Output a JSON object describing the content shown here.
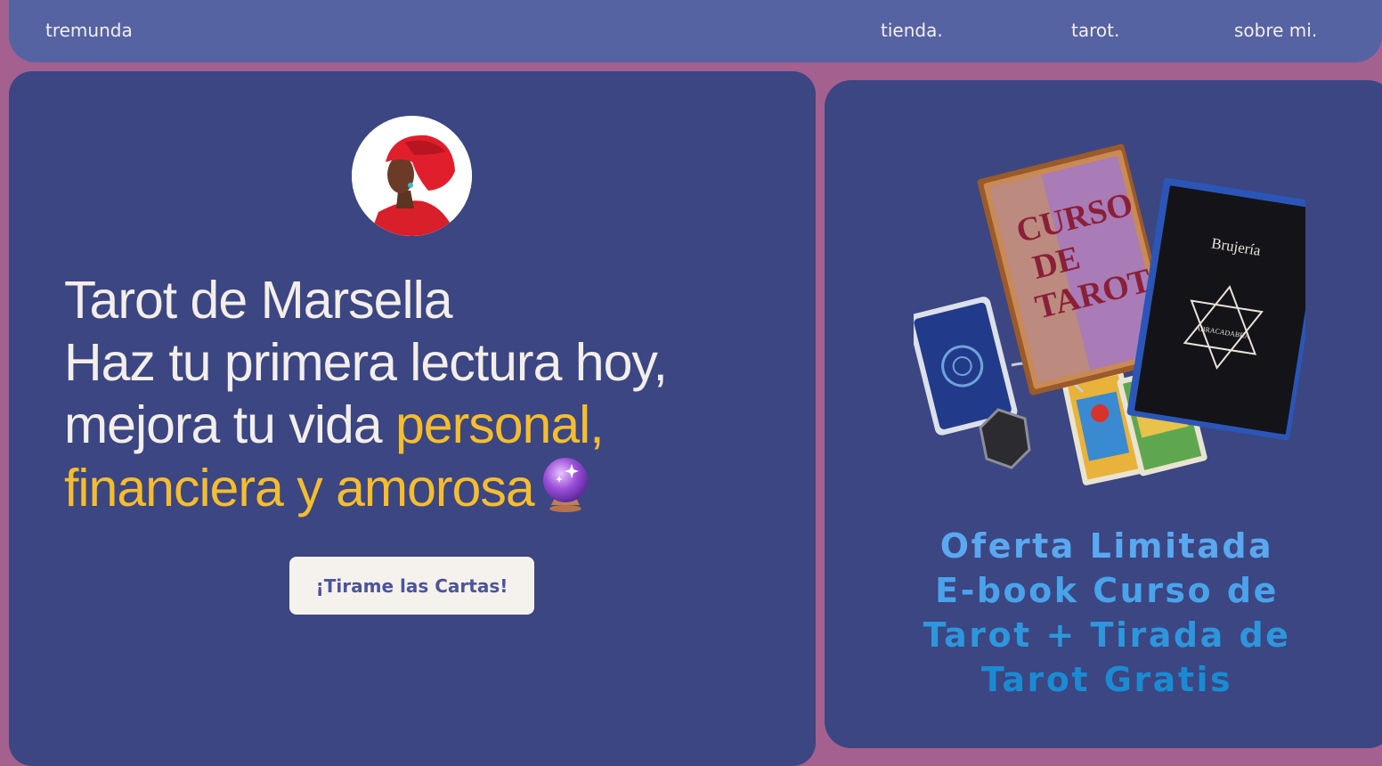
{
  "nav": {
    "brand": "tremunda",
    "links": [
      "tienda.",
      "tarot.",
      "sobre mi."
    ]
  },
  "hero": {
    "avatar": "tarot-reader-avatar",
    "title": "Tarot de Marsella",
    "line2": "Haz tu primera lectura hoy,",
    "line3_plain": "mejora tu vida ",
    "line3_accent": "personal,",
    "line4_accent": "financiera y amorosa",
    "cta_label": "¡Tirame las Cartas!"
  },
  "promo": {
    "image": "tarot-ebook-bundle",
    "book1_title_a": "CURSO",
    "book1_title_b": "DE",
    "book1_title_c": "TAROT",
    "book2_title": "Brujería",
    "offer_line1": "Oferta Limitada",
    "offer_line2": " E-book Curso de",
    "offer_line3": "Tarot + Tirada de",
    "offer_line4": "Tarot Gratis"
  },
  "colors": {
    "page": "#a4608f",
    "nav": "#5563a3",
    "card": "#3b4682",
    "accent": "#f5bd2e",
    "offer": "#4aa3ea"
  }
}
